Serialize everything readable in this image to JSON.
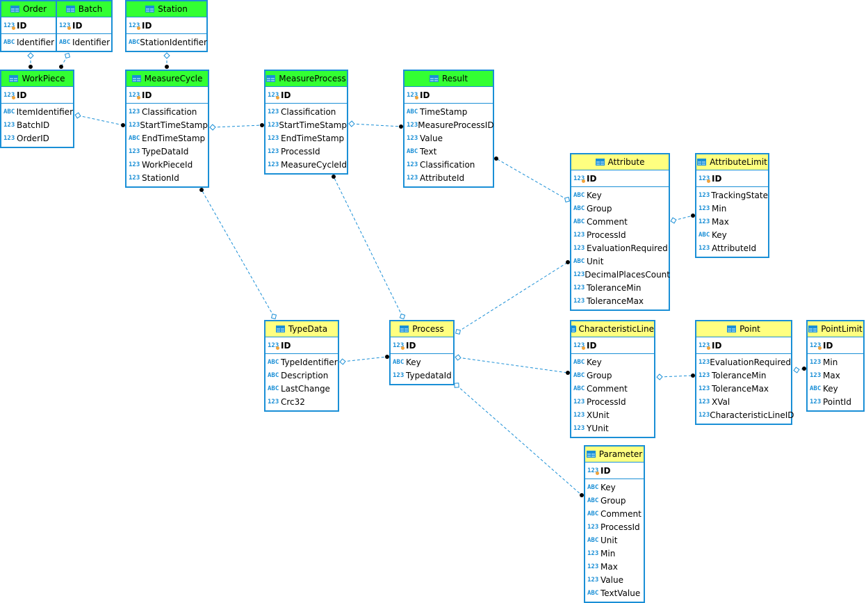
{
  "colors": {
    "border": "#1a8fd6",
    "header_green": "#33ff33",
    "header_yellow": "#ffff80",
    "link": "#1a8fd6"
  },
  "icons": {
    "table": "table-icon",
    "number": "123",
    "text": "ABC",
    "primary_key": "key-icon"
  },
  "tables": [
    {
      "name": "Order",
      "color": "green",
      "id": "ID",
      "columns": [
        [
          "ABC",
          "Identifier"
        ]
      ]
    },
    {
      "name": "Batch",
      "color": "green",
      "id": "ID",
      "columns": [
        [
          "ABC",
          "Identifier"
        ]
      ]
    },
    {
      "name": "Station",
      "color": "green",
      "id": "ID",
      "columns": [
        [
          "ABC",
          "StationIdentifier"
        ]
      ]
    },
    {
      "name": "WorkPiece",
      "color": "green",
      "id": "ID",
      "columns": [
        [
          "ABC",
          "ItemIdentifier"
        ],
        [
          "123",
          "BatchID"
        ],
        [
          "123",
          "OrderID"
        ]
      ]
    },
    {
      "name": "MeasureCycle",
      "color": "green",
      "id": "ID",
      "columns": [
        [
          "123",
          "Classification"
        ],
        [
          "123",
          "StartTimeStamp"
        ],
        [
          "ABC",
          "EndTimeStamp"
        ],
        [
          "123",
          "TypeDataId"
        ],
        [
          "123",
          "WorkPieceId"
        ],
        [
          "123",
          "StationId"
        ]
      ]
    },
    {
      "name": "MeasureProcess",
      "color": "green",
      "id": "ID",
      "columns": [
        [
          "123",
          "Classification"
        ],
        [
          "123",
          "StartTimeStamp"
        ],
        [
          "123",
          "EndTimeStamp"
        ],
        [
          "123",
          "ProcessId"
        ],
        [
          "123",
          "MeasureCycleId"
        ]
      ]
    },
    {
      "name": "Result",
      "color": "green",
      "id": "ID",
      "columns": [
        [
          "ABC",
          "TimeStamp"
        ],
        [
          "123",
          "MeasureProcessID"
        ],
        [
          "123",
          "Value"
        ],
        [
          "ABC",
          "Text"
        ],
        [
          "123",
          "Classification"
        ],
        [
          "123",
          "AttributeId"
        ]
      ]
    },
    {
      "name": "Attribute",
      "color": "yellow",
      "id": "ID",
      "columns": [
        [
          "ABC",
          "Key"
        ],
        [
          "ABC",
          "Group"
        ],
        [
          "ABC",
          "Comment"
        ],
        [
          "123",
          "ProcessId"
        ],
        [
          "123",
          "EvaluationRequired"
        ],
        [
          "ABC",
          "Unit"
        ],
        [
          "123",
          "DecimalPlacesCount"
        ],
        [
          "123",
          "ToleranceMin"
        ],
        [
          "123",
          "ToleranceMax"
        ]
      ]
    },
    {
      "name": "AttributeLimit",
      "color": "yellow",
      "id": "ID",
      "columns": [
        [
          "123",
          "TrackingState"
        ],
        [
          "123",
          "Min"
        ],
        [
          "123",
          "Max"
        ],
        [
          "ABC",
          "Key"
        ],
        [
          "123",
          "AttributeId"
        ]
      ]
    },
    {
      "name": "TypeData",
      "color": "yellow",
      "id": "ID",
      "columns": [
        [
          "ABC",
          "TypeIdentifier"
        ],
        [
          "ABC",
          "Description"
        ],
        [
          "ABC",
          "LastChange"
        ],
        [
          "123",
          "Crc32"
        ]
      ]
    },
    {
      "name": "Process",
      "color": "yellow",
      "id": "ID",
      "columns": [
        [
          "ABC",
          "Key"
        ],
        [
          "123",
          "TypedataId"
        ]
      ]
    },
    {
      "name": "CharacteristicLine",
      "color": "yellow",
      "id": "ID",
      "columns": [
        [
          "ABC",
          "Key"
        ],
        [
          "ABC",
          "Group"
        ],
        [
          "ABC",
          "Comment"
        ],
        [
          "123",
          "ProcessId"
        ],
        [
          "123",
          "XUnit"
        ],
        [
          "123",
          "YUnit"
        ]
      ]
    },
    {
      "name": "Point",
      "color": "yellow",
      "id": "ID",
      "columns": [
        [
          "123",
          "EvaluationRequired"
        ],
        [
          "123",
          "ToleranceMin"
        ],
        [
          "123",
          "ToleranceMax"
        ],
        [
          "123",
          "XVal"
        ],
        [
          "123",
          "CharacteristicLineID"
        ]
      ]
    },
    {
      "name": "PointLimit",
      "color": "yellow",
      "id": "ID",
      "columns": [
        [
          "123",
          "Min"
        ],
        [
          "123",
          "Max"
        ],
        [
          "ABC",
          "Key"
        ],
        [
          "123",
          "PointId"
        ]
      ]
    },
    {
      "name": "Parameter",
      "color": "yellow",
      "id": "ID",
      "columns": [
        [
          "ABC",
          "Key"
        ],
        [
          "ABC",
          "Group"
        ],
        [
          "ABC",
          "Comment"
        ],
        [
          "123",
          "ProcessId"
        ],
        [
          "ABC",
          "Unit"
        ],
        [
          "123",
          "Min"
        ],
        [
          "123",
          "Max"
        ],
        [
          "123",
          "Value"
        ],
        [
          "ABC",
          "TextValue"
        ]
      ]
    }
  ],
  "relations": [
    {
      "parent": "Order",
      "child": "WorkPiece"
    },
    {
      "parent": "Batch",
      "child": "WorkPiece"
    },
    {
      "parent": "Station",
      "child": "MeasureCycle"
    },
    {
      "parent": "WorkPiece",
      "child": "MeasureCycle"
    },
    {
      "parent": "MeasureCycle",
      "child": "MeasureProcess"
    },
    {
      "parent": "MeasureProcess",
      "child": "Result"
    },
    {
      "parent": "Attribute",
      "child": "Result"
    },
    {
      "parent": "Attribute",
      "child": "AttributeLimit"
    },
    {
      "parent": "TypeData",
      "child": "MeasureCycle"
    },
    {
      "parent": "Process",
      "child": "MeasureProcess"
    },
    {
      "parent": "TypeData",
      "child": "Process"
    },
    {
      "parent": "Process",
      "child": "Attribute"
    },
    {
      "parent": "Process",
      "child": "CharacteristicLine"
    },
    {
      "parent": "CharacteristicLine",
      "child": "Point"
    },
    {
      "parent": "Point",
      "child": "PointLimit"
    },
    {
      "parent": "Process",
      "child": "Parameter"
    }
  ]
}
